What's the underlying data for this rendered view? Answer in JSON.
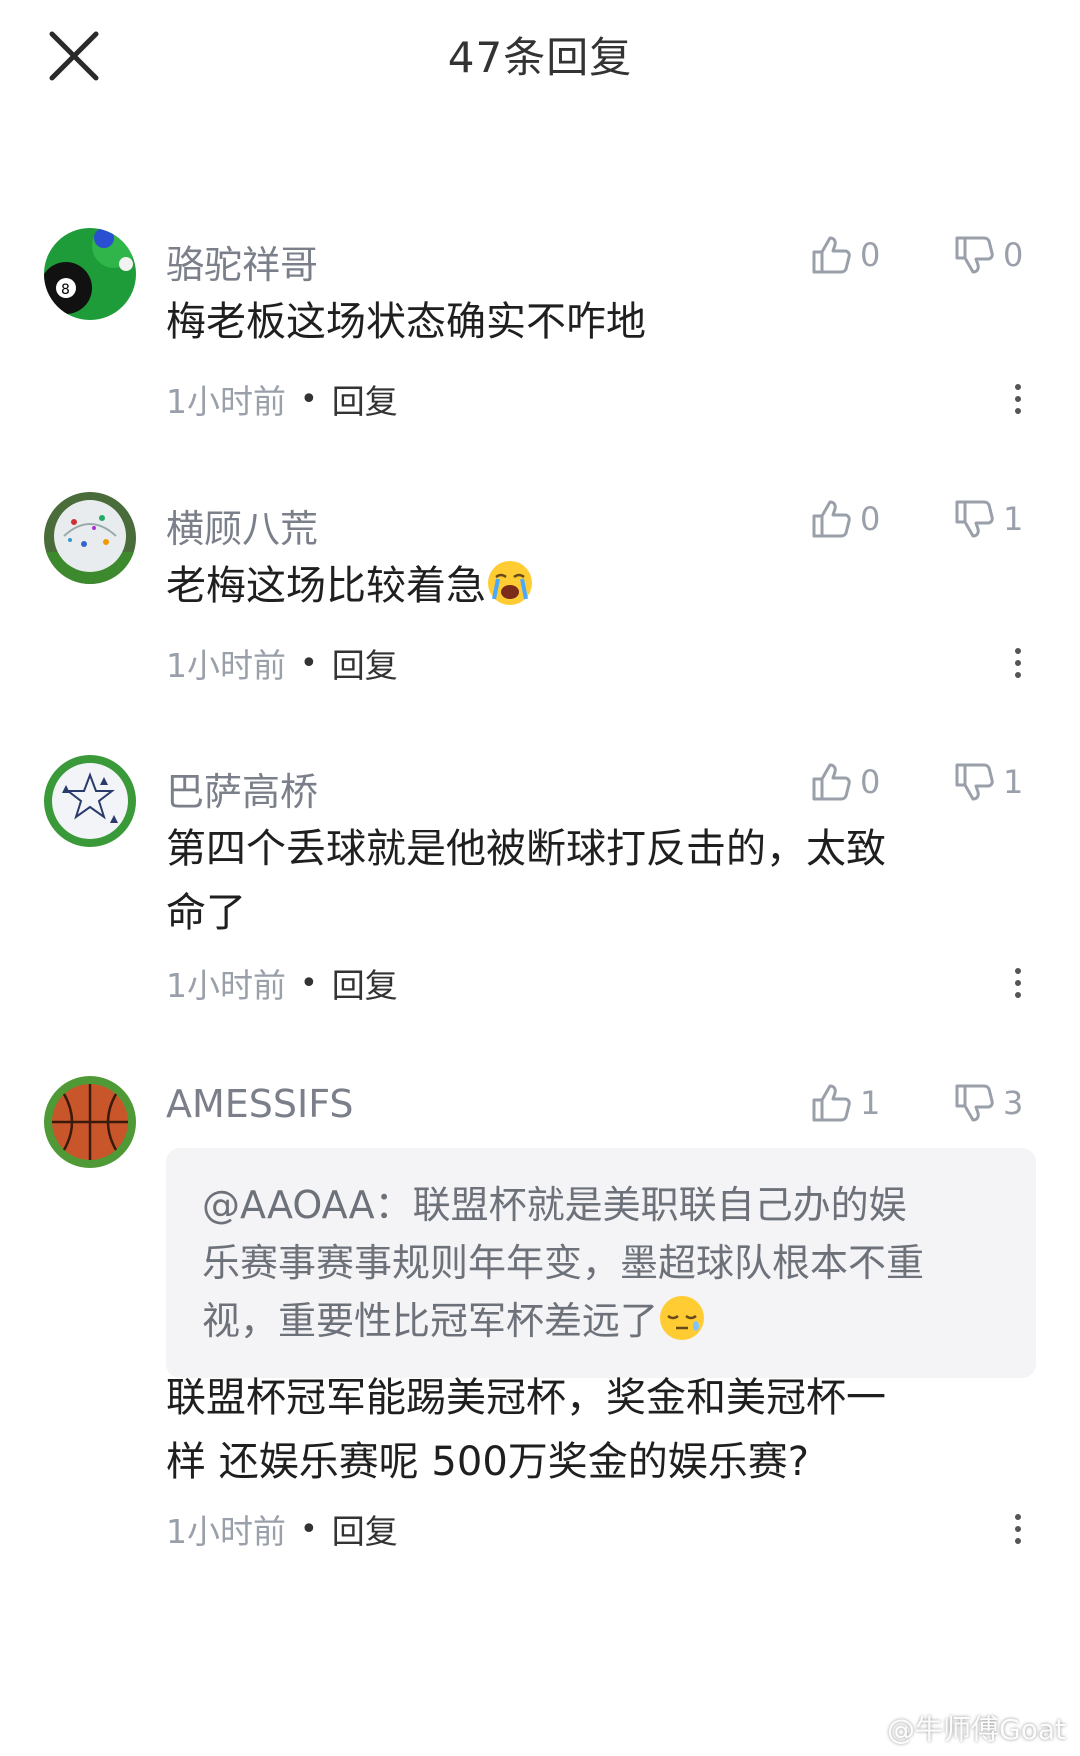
{
  "header": {
    "title": "47条回复",
    "close_icon": "close-icon"
  },
  "comments": [
    {
      "username": "骆驼祥哥",
      "avatar": "billiard-ball-avatar",
      "likes": "0",
      "dislikes": "0",
      "content": "梅老板这场状态确实不咋地",
      "time": "1小时前",
      "reply_label": "回复"
    },
    {
      "username": "横顾八荒",
      "avatar": "soccer-ball-avatar",
      "likes": "0",
      "dislikes": "1",
      "content": "老梅这场比较着急",
      "content_emoji": "crying-face-emoji",
      "time": "1小时前",
      "reply_label": "回复"
    },
    {
      "username": "巴萨高桥",
      "avatar": "champions-league-ball-avatar",
      "likes": "0",
      "dislikes": "1",
      "content_line1": "第四个丢球就是他被断球打反击的，太致",
      "content_line2": "命了",
      "time": "1小时前",
      "reply_label": "回复"
    },
    {
      "username": "AMESSIFS",
      "avatar": "basketball-avatar",
      "likes": "1",
      "dislikes": "3",
      "quote_line1": "@AAOAA：联盟杯就是美职联自己办的娱",
      "quote_line2": "乐赛事赛事规则年年变，墨超球队根本不重",
      "quote_line3": "视，重要性比冠军杯差远了",
      "quote_emoji": "sleepy-face-emoji",
      "content_line1": "联盟杯冠军能踢美冠杯，奖金和美冠杯一",
      "content_line2": "样 还娱乐赛呢 500万奖金的娱乐赛?",
      "time": "1小时前",
      "reply_label": "回复"
    }
  ],
  "watermark": "@牛师傅Goat",
  "colors": {
    "username": "#7a7f8a",
    "muted": "#9aa0aa",
    "text": "#1f1f1f",
    "quote_bg": "#f4f4f6"
  }
}
